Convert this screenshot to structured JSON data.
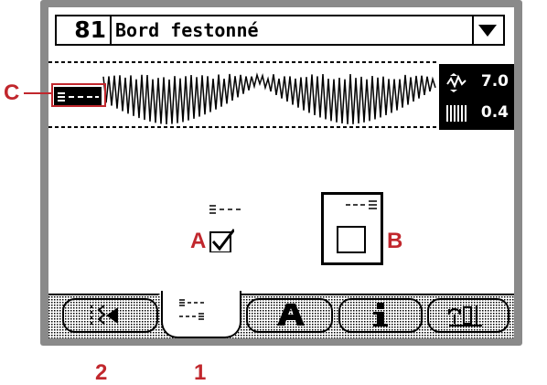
{
  "header": {
    "stitch_number": "81",
    "stitch_name": "Bord festonné"
  },
  "settings": {
    "width_icon": "stitch-width-icon",
    "width_value": "7.0",
    "length_icon": "stitch-length-icon",
    "length_value": "0.4"
  },
  "options": {
    "mirror_a_checked": true,
    "mirror_b_checked": false
  },
  "tabs": [
    {
      "icon": "stitch-menu-icon"
    },
    {
      "icon": "mirror-settings-icon",
      "selected": true
    },
    {
      "icon": "font-icon"
    },
    {
      "icon": "info-icon"
    },
    {
      "icon": "settings-tools-icon"
    }
  ],
  "callouts": {
    "a": "A",
    "b": "B",
    "c": "C",
    "one": "1",
    "two": "2"
  },
  "colors": {
    "callout": "#c1272d",
    "frame": "#8a8a8a"
  }
}
